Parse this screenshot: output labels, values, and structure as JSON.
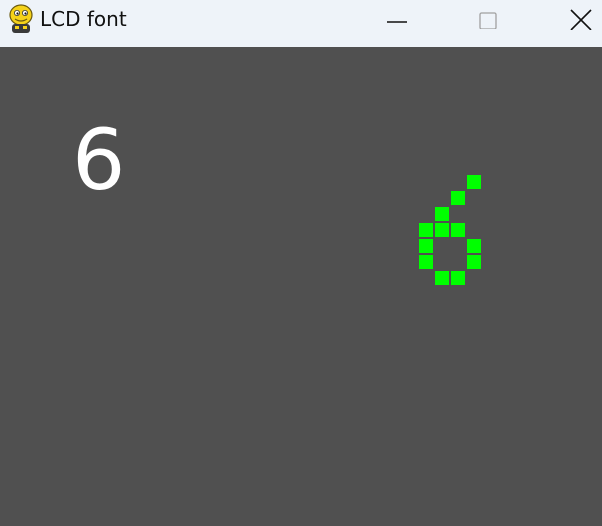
{
  "window": {
    "title": "LCD font",
    "app_icon": "pygame-snake-icon",
    "controls": {
      "minimize_icon": "minimize-icon",
      "maximize_icon": "maximize-icon",
      "close_icon": "close-icon"
    }
  },
  "content": {
    "background_color": "#505050",
    "text_digit": "6",
    "text_digit_color": "#ffffff",
    "lcd_digit": {
      "value": "6",
      "color": "#00ff00",
      "rows": [
        "00001",
        "00010",
        "00100",
        "01110",
        "01001",
        "01001",
        "00110"
      ]
    }
  }
}
